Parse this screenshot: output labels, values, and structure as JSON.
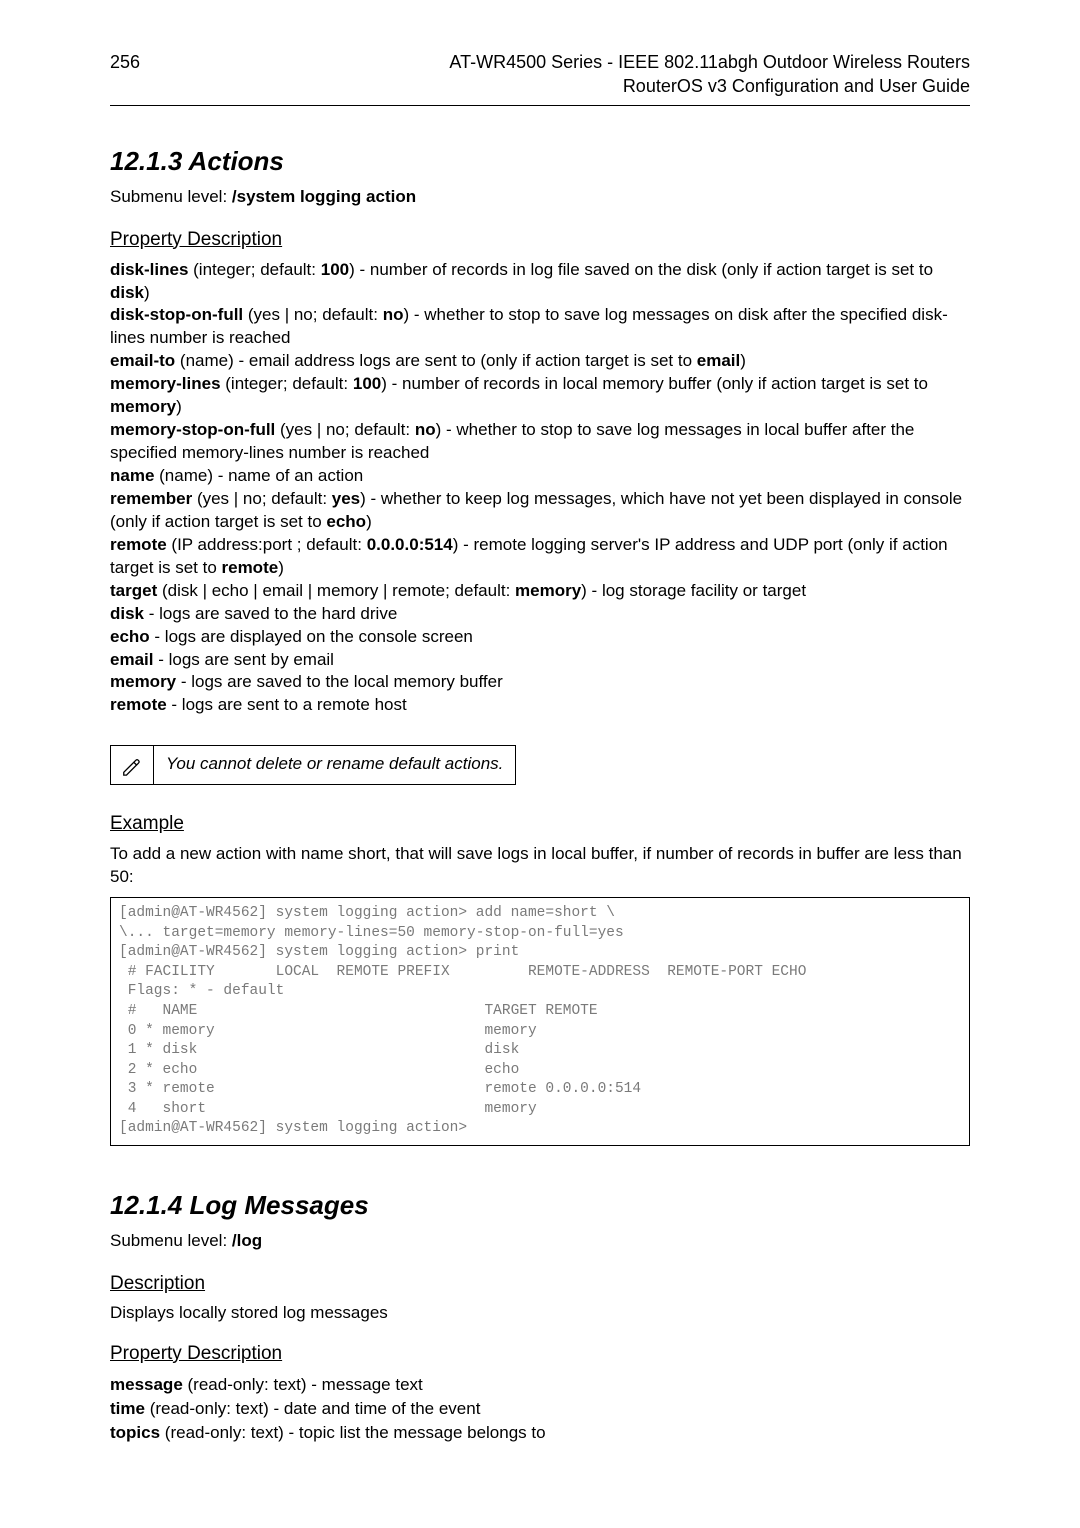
{
  "header": {
    "page_number": "256",
    "title_line1": "AT-WR4500 Series - IEEE 802.11abgh Outdoor Wireless Routers",
    "title_line2": "RouterOS v3 Configuration and User Guide"
  },
  "s1213": {
    "heading": "12.1.3    Actions",
    "submenu_prefix": "Submenu level: ",
    "submenu_value": "/system logging action",
    "pd_heading": "Property Description",
    "p1a": "disk-lines",
    "p1b": " (integer; default: ",
    "p1c": "100",
    "p1d": ") - number of records in log file saved on the disk (only if action target is set to ",
    "p1e": "disk",
    "p1f": ")",
    "p2a": "disk-stop-on-full",
    "p2b": " (yes | no; default: ",
    "p2c": "no",
    "p2d": ") - whether to stop to save log messages on disk after the specified disk-lines number is reached",
    "p3a": "email-to",
    "p3b": " (name) - email address logs are sent to (only if action target is set to ",
    "p3c": "email",
    "p3d": ")",
    "p4a": "memory-lines",
    "p4b": " (integer; default: ",
    "p4c": "100",
    "p4d": ") - number of records in local memory buffer (only if action target is set to ",
    "p4e": "memory",
    "p4f": ")",
    "p5a": "memory-stop-on-full",
    "p5b": " (yes | no; default: ",
    "p5c": "no",
    "p5d": ") - whether to stop to save log messages in local buffer after the specified memory-lines number is reached",
    "p6a": "name",
    "p6b": " (name) - name of an action",
    "p7a": "remember",
    "p7b": " (yes | no; default: ",
    "p7c": "yes",
    "p7d": ") - whether to keep log messages, which have not yet been displayed in console (only if action target is set to ",
    "p7e": "echo",
    "p7f": ")",
    "p8a": "remote",
    "p8b": " (IP address:port ; default: ",
    "p8c": "0.0.0.0:514",
    "p8d": ") - remote logging server's IP address and UDP port (only if action target is set to ",
    "p8e": "remote",
    "p8f": ")",
    "p9a": "target",
    "p9b": " (disk | echo | email | memory | remote; default: ",
    "p9c": "memory",
    "p9d": ") - log storage facility or target",
    "p10a": "disk",
    "p10b": " - logs are saved to the hard drive",
    "p11a": "echo",
    "p11b": " - logs are displayed on the console screen",
    "p12a": "email",
    "p12b": " - logs are sent by email",
    "p13a": "memory",
    "p13b": " - logs are saved to the local memory buffer",
    "p14a": "remote",
    "p14b": " - logs are sent to a remote host",
    "note_icon": "✎",
    "note_text": "You cannot delete or rename default actions.",
    "ex_heading": "Example",
    "ex_desc": "To add a new action with name short, that will save logs in local buffer, if number of records in buffer are less than 50:",
    "code": "[admin@AT-WR4562] system logging action> add name=short \\\n\\... target=memory memory-lines=50 memory-stop-on-full=yes\n[admin@AT-WR4562] system logging action> print\n # FACILITY       LOCAL  REMOTE PREFIX         REMOTE-ADDRESS  REMOTE-PORT ECHO\n Flags: * - default\n #   NAME                                 TARGET REMOTE\n 0 * memory                               memory\n 1 * disk                                 disk\n 2 * echo                                 echo\n 3 * remote                               remote 0.0.0.0:514\n 4   short                                memory\n[admin@AT-WR4562] system logging action>"
  },
  "s1214": {
    "heading": "12.1.4    Log Messages",
    "submenu_prefix": "Submenu level: ",
    "submenu_value": "/log",
    "desc_heading": "Description",
    "desc_text": "Displays locally stored log messages",
    "pd_heading": "Property Description",
    "p1a": "message",
    "p1b": " (read-only: text) - message text",
    "p2a": "time",
    "p2b": " (read-only: text) - date and time of the event",
    "p3a": "topics",
    "p3b": " (read-only: text) - topic list the message belongs to"
  }
}
